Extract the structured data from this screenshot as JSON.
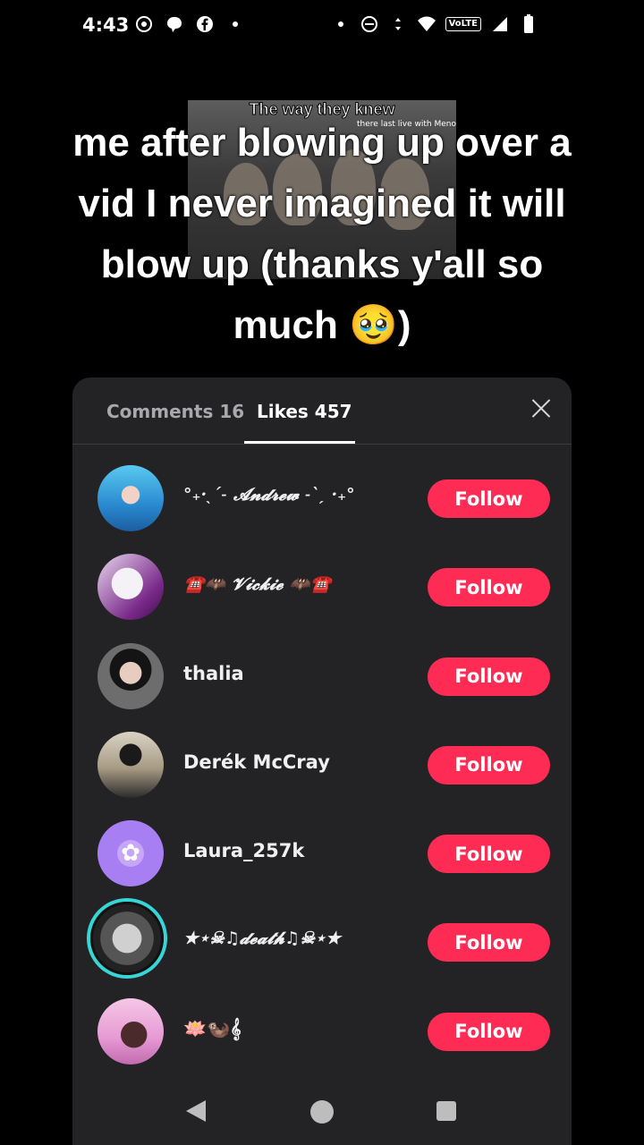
{
  "status_bar": {
    "time": "4:43",
    "network_label": "VoLTE",
    "icons": [
      "sim-icon",
      "chat-icon",
      "facebook-icon",
      "dot-icon",
      "dot-icon",
      "dnd-icon",
      "data-arrows-icon",
      "wifi-icon",
      "signal-icon",
      "battery-icon"
    ]
  },
  "video": {
    "overlay_title": "The way they knew",
    "overlay_subtitle": "there last live with Meno"
  },
  "caption": {
    "line1": "me after blowing up over a",
    "line2": "vid I never imagined it will",
    "line3": "blow up (thanks y'all so",
    "line4": "much 🥹)"
  },
  "sheet": {
    "tab_comments": "Comments 16",
    "tab_likes": "Likes 457",
    "active_tab": "Likes 457",
    "likes": [
      {
        "name": "°₊·ˎˊ˗ 𝓐𝓷𝓭𝓻𝓮𝔀 ˗ˋˏ ·₊°",
        "button": "Follow"
      },
      {
        "name": "☎️🦇 𝓥𝓲𝓬𝓴𝓲𝓮 🦇☎️",
        "button": "Follow"
      },
      {
        "name": "thalia",
        "button": "Follow"
      },
      {
        "name": "Derék McCray",
        "button": "Follow"
      },
      {
        "name": "Laura_257k",
        "button": "Follow"
      },
      {
        "name": "★⋆☠︎♫𝓭𝓮𝓪𝓽𝓱♫☠︎⋆★",
        "button": "Follow"
      },
      {
        "name": "🪷🦦𝄞",
        "button": "Follow"
      }
    ]
  },
  "colors": {
    "follow": "#fe2c55",
    "sheet_bg": "#232325",
    "tab_inactive": "#a9a9ad"
  }
}
